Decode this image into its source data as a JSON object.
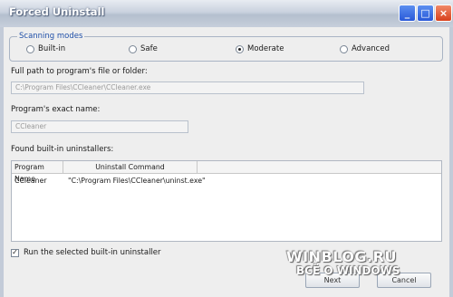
{
  "window": {
    "title": "Forced Uninstall",
    "minimize_glyph": "_",
    "maximize_glyph": "□",
    "close_glyph": "×"
  },
  "scanning_modes": {
    "legend": "Scanning modes",
    "options": [
      {
        "label": "Built-in",
        "selected": false
      },
      {
        "label": "Safe",
        "selected": false
      },
      {
        "label": "Moderate",
        "selected": true
      },
      {
        "label": "Advanced",
        "selected": false
      }
    ]
  },
  "path_field": {
    "label": "Full path to program's file or folder:",
    "value": "C:\\Program Files\\CCleaner\\CCleaner.exe"
  },
  "name_field": {
    "label": "Program's exact name:",
    "value": "CCleaner"
  },
  "installers": {
    "label": "Found built-in uninstallers:",
    "columns": [
      "Program Name",
      "Uninstall Command"
    ],
    "rows": [
      {
        "name": "CCleaner",
        "command": "\"C:\\Program Files\\CCleaner\\uninst.exe\""
      }
    ]
  },
  "run_checkbox": {
    "label": "Run the selected built-in uninstaller",
    "checked": true,
    "glyph": "✓"
  },
  "buttons": {
    "next": "Next",
    "cancel": "Cancel"
  },
  "watermark": {
    "line1": "WINBLOG.RU",
    "line2": "ВСЁ О WINDOWS"
  },
  "colors": {
    "accent": "#1f4fa8",
    "titlebar": "#c9d1de",
    "close_button": "#d8401c"
  }
}
